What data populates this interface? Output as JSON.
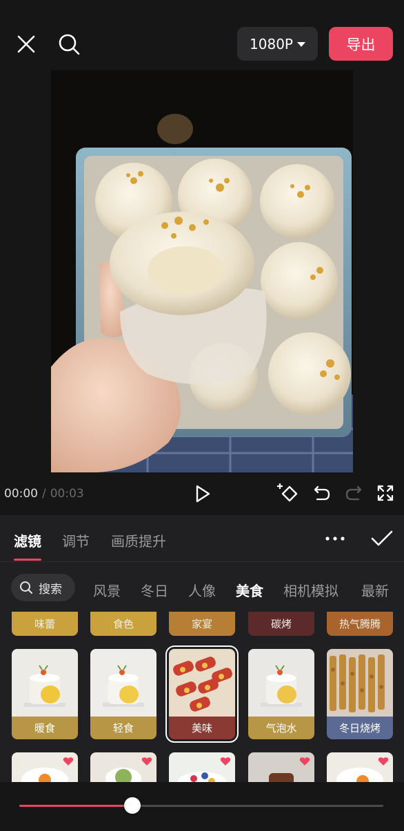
{
  "topbar": {
    "resolution": "1080P",
    "export_label": "导出"
  },
  "playback": {
    "current_time": "00:00",
    "separator": "/",
    "total_time": "00:03"
  },
  "panel": {
    "tabs": [
      {
        "label": "滤镜",
        "active": true
      },
      {
        "label": "调节",
        "active": false
      },
      {
        "label": "画质提升",
        "active": false
      }
    ],
    "search_label": "搜索",
    "categories": [
      {
        "label": "风景",
        "active": false
      },
      {
        "label": "冬日",
        "active": false
      },
      {
        "label": "人像",
        "active": false
      },
      {
        "label": "美食",
        "active": true
      },
      {
        "label": "相机模拟",
        "active": false
      },
      {
        "label": "最新",
        "active": false
      }
    ],
    "filter_row1": [
      {
        "label": "味蕾",
        "color": "#c9a23e"
      },
      {
        "label": "食色",
        "color": "#c9a23e"
      },
      {
        "label": "家宴",
        "color": "#b67f35"
      },
      {
        "label": "碳烤",
        "color": "#5c2a2a"
      },
      {
        "label": "热气腾腾",
        "color": "#a8642c"
      }
    ],
    "filter_row2": [
      {
        "label": "暖食",
        "color": "#b79646",
        "thumb": "cake",
        "selected": false
      },
      {
        "label": "轻食",
        "color": "#b79646",
        "thumb": "cake",
        "selected": false
      },
      {
        "label": "美味",
        "color": "#8a3a33",
        "thumb": "bacon",
        "selected": true
      },
      {
        "label": "气泡水",
        "color": "#b79646",
        "thumb": "cake",
        "selected": false
      },
      {
        "label": "冬日烧烤",
        "color": "#5a6a94",
        "thumb": "skewers",
        "selected": false
      }
    ],
    "filter_row3": [
      {
        "thumb": "egg",
        "badge": true
      },
      {
        "thumb": "matcha",
        "badge": true
      },
      {
        "thumb": "fruit",
        "badge": true
      },
      {
        "thumb": "dark",
        "badge": true
      },
      {
        "thumb": "egg",
        "badge": true
      }
    ]
  },
  "slider": {
    "value": 0.31
  }
}
